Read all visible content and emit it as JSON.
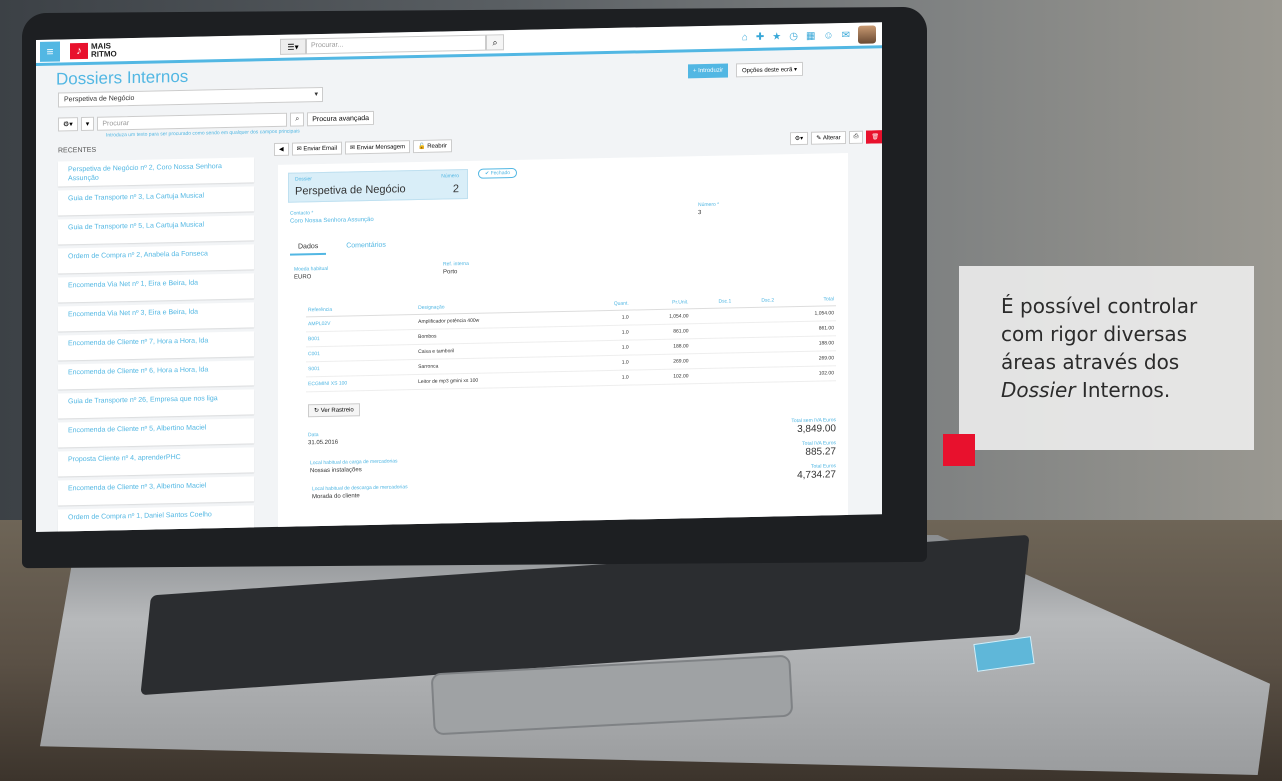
{
  "app": {
    "brand_line1": "MAIS",
    "brand_line2": "RITMO",
    "search_placeholder": "Procurar...",
    "page_title": "Dossiers Internos",
    "introduzir_label": "+ Introduzir",
    "opcoes_label": "Opções deste ecrã ▾",
    "selected_type": "Perspetiva de Negócio",
    "filter_placeholder": "Procurar",
    "procura_avancada": "Procura avançada",
    "filter_hint": "Introduza um texto para ser procurado como sendo em qualquer dos campos principais",
    "recentes_label": "RECENTES"
  },
  "recent_items": [
    "Perspetiva de Negócio nº 2, Coro Nossa Senhora Assunção",
    "Guia de Transporte nº 3, La Cartuja Musical",
    "Guia de Transporte nº 5, La Cartuja Musical",
    "Ordem de Compra nº 2, Anabela da Fonseca",
    "Encomenda Via Net nº 1, Eira e Beira, lda",
    "Encomenda Via Net nº 3, Eira e Beira, lda",
    "Encomenda de Cliente nº 7, Hora a Hora, lda",
    "Encomenda de Cliente nº 6, Hora a Hora, lda",
    "Guia de Transporte nº 26, Empresa que nos liga",
    "Encomenda de Cliente nº 5, Albertino Maciel",
    "Proposta Cliente nº 4, aprenderPHC",
    "Encomenda de Cliente nº 3, Albertino Maciel",
    "Ordem de Compra nº 1, Daniel Santos Coelho"
  ],
  "actions": {
    "enviar_email": "Enviar Email",
    "enviar_mensagem": "Enviar Mensagem",
    "reabrir": "Reabrir",
    "alterar": "Alterar"
  },
  "record": {
    "dossier_label": "Dossier",
    "dossier_value": "Perspetiva de Negócio",
    "numero_label": "Número",
    "numero_value": "2",
    "status": "Fechado",
    "contacto_label": "Contacto *",
    "contacto_value": "Coro Nossa Senhora Assunção",
    "numero2_label": "Número *",
    "numero2_value": "3",
    "tabs": [
      "Dados",
      "Comentários"
    ],
    "moeda_label": "Moeda habitual",
    "moeda_value": "EURO",
    "ref_interna_label": "Ref. interna",
    "ref_interna_value": "Porto",
    "ver_rastreio": "Ver Rastreio",
    "data_label": "Data",
    "data_value": "31.05.2016",
    "local_carga_label": "Local habitual da carga de mercadorias",
    "local_carga_value": "Nossas instalações",
    "local_descarga_label": "Local habitual de descarga de mercadorias",
    "local_descarga_value": "Morada do cliente"
  },
  "lines": {
    "headers": [
      "Referência",
      "Designação",
      "Quant.",
      "Pr.Unit.",
      "Dsc.1",
      "Dsc.2",
      "Total"
    ],
    "rows": [
      [
        "AMPL02V",
        "Amplificador potência 400w",
        "1.0",
        "1,054.00",
        "",
        "",
        "1,054.00"
      ],
      [
        "B001",
        "Bombos",
        "1.0",
        "861.00",
        "",
        "",
        "861.00"
      ],
      [
        "C001",
        "Caixa e tamboril",
        "1.0",
        "188.00",
        "",
        "",
        "188.00"
      ],
      [
        "S001",
        "Sarronca",
        "1.0",
        "269.00",
        "",
        "",
        "269.00"
      ],
      [
        "ECGMINI XS 100",
        "Leitor de mp3 gmini xs 100",
        "1.0",
        "102.00",
        "",
        "",
        "102.00"
      ]
    ]
  },
  "totals": {
    "sem_iva_label": "Total sem IVA Euros",
    "sem_iva_value": "3,849.00",
    "iva_label": "Total IVA Euros",
    "iva_value": "885.27",
    "total_label": "Total Euros",
    "total_value": "4,734.27"
  },
  "overlay": {
    "line1": "É possível controlar com rigor diversas áreas através dos",
    "italic": "Dossier",
    "line2": " Internos."
  },
  "colors": {
    "accent": "#52b7e3",
    "brand_red": "#e8112d"
  }
}
